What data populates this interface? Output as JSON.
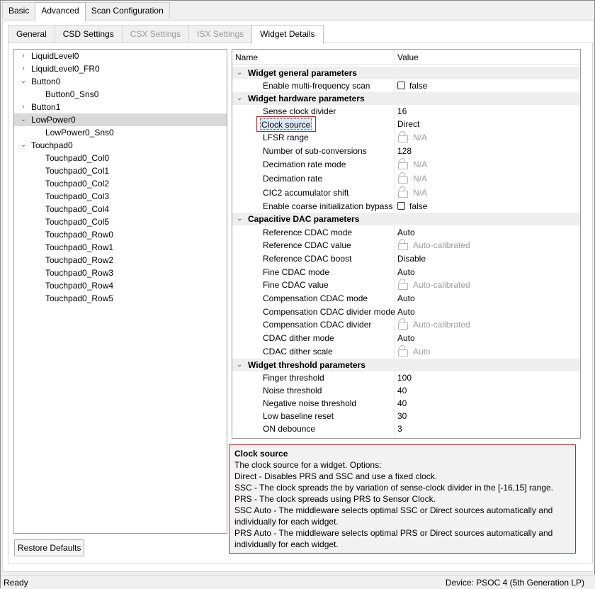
{
  "top_tabs": [
    "Basic",
    "Advanced",
    "Scan Configuration"
  ],
  "sub_tabs": [
    "General",
    "CSD Settings",
    "CSX Settings",
    "ISX Settings",
    "Widget Details"
  ],
  "tree": [
    {
      "label": "LiquidLevel0",
      "toggle": "›"
    },
    {
      "label": "LiquidLevel0_FR0",
      "toggle": "›"
    },
    {
      "label": "Button0",
      "toggle": "⌄"
    },
    {
      "label": "Button0_Sns0",
      "toggle": ""
    },
    {
      "label": "Button1",
      "toggle": "›"
    },
    {
      "label": "LowPower0",
      "toggle": "⌄"
    },
    {
      "label": "LowPower0_Sns0",
      "toggle": ""
    },
    {
      "label": "Touchpad0",
      "toggle": "⌄"
    },
    {
      "label": "Touchpad0_Col0",
      "toggle": ""
    },
    {
      "label": "Touchpad0_Col1",
      "toggle": ""
    },
    {
      "label": "Touchpad0_Col2",
      "toggle": ""
    },
    {
      "label": "Touchpad0_Col3",
      "toggle": ""
    },
    {
      "label": "Touchpad0_Col4",
      "toggle": ""
    },
    {
      "label": "Touchpad0_Col5",
      "toggle": ""
    },
    {
      "label": "Touchpad0_Row0",
      "toggle": ""
    },
    {
      "label": "Touchpad0_Row1",
      "toggle": ""
    },
    {
      "label": "Touchpad0_Row2",
      "toggle": ""
    },
    {
      "label": "Touchpad0_Row3",
      "toggle": ""
    },
    {
      "label": "Touchpad0_Row4",
      "toggle": ""
    },
    {
      "label": "Touchpad0_Row5",
      "toggle": ""
    }
  ],
  "restore_defaults": "Restore Defaults",
  "grid": {
    "col_name": "Name",
    "col_value": "Value",
    "categories": {
      "general": "Widget general parameters",
      "hardware": "Widget hardware parameters",
      "cdac": "Capacitive DAC parameters",
      "threshold": "Widget threshold parameters"
    },
    "rows": [
      {
        "name": "Enable multi-frequency scan",
        "value": "false",
        "kind": "checkbox"
      },
      {
        "name": "Sense clock divider",
        "value": "16",
        "kind": "text"
      },
      {
        "name": "Clock source",
        "value": "Direct",
        "kind": "text"
      },
      {
        "name": "LFSR range",
        "value": "N/A",
        "kind": "locked"
      },
      {
        "name": "Number of sub-conversions",
        "value": "128",
        "kind": "text"
      },
      {
        "name": "Decimation rate mode",
        "value": "N/A",
        "kind": "locked"
      },
      {
        "name": "Decimation rate",
        "value": "N/A",
        "kind": "locked"
      },
      {
        "name": "CIC2 accumulator shift",
        "value": "N/A",
        "kind": "locked"
      },
      {
        "name": "Enable coarse initialization bypass",
        "value": "false",
        "kind": "checkbox"
      },
      {
        "name": "Reference CDAC mode",
        "value": "Auto",
        "kind": "text"
      },
      {
        "name": "Reference CDAC value",
        "value": "Auto-calibrated",
        "kind": "locked"
      },
      {
        "name": "Reference CDAC boost",
        "value": "Disable",
        "kind": "text"
      },
      {
        "name": "Fine CDAC mode",
        "value": "Auto",
        "kind": "text"
      },
      {
        "name": "Fine CDAC value",
        "value": "Auto-calibrated",
        "kind": "locked"
      },
      {
        "name": "Compensation CDAC mode",
        "value": "Auto",
        "kind": "text"
      },
      {
        "name": "Compensation CDAC divider mode",
        "value": "Auto",
        "kind": "text"
      },
      {
        "name": "Compensation CDAC divider",
        "value": "Auto-calibrated",
        "kind": "locked"
      },
      {
        "name": "CDAC dither mode",
        "value": "Auto",
        "kind": "text"
      },
      {
        "name": "CDAC dither scale",
        "value": "Auto",
        "kind": "locked"
      },
      {
        "name": "Finger threshold",
        "value": "100",
        "kind": "text"
      },
      {
        "name": "Noise threshold",
        "value": "40",
        "kind": "text"
      },
      {
        "name": "Negative noise threshold",
        "value": "40",
        "kind": "text"
      },
      {
        "name": "Low baseline reset",
        "value": "30",
        "kind": "text"
      },
      {
        "name": "ON debounce",
        "value": "3",
        "kind": "text"
      }
    ]
  },
  "description": {
    "title": "Clock source",
    "lines": [
      "The clock source for a widget. Options:",
      "Direct - Disables PRS and SSC and use a fixed clock.",
      "SSC - The clock spreads the by variation of sense-clock divider in the [-16,15] range.",
      "PRS - The clock spreads using PRS to Sensor Clock.",
      "SSC Auto - The middleware selects optimal SSC or Direct sources automatically and",
      "individually for each widget.",
      "PRS Auto - The middleware selects optimal PRS or Direct sources automatically and",
      "individually for each widget."
    ]
  },
  "status": {
    "left": "Ready",
    "right": "Device: PSOC 4 (5th Generation LP)"
  },
  "icons": {
    "lock": "lock-icon",
    "expand": "chevron-right-icon",
    "collapse": "chevron-down-icon"
  }
}
